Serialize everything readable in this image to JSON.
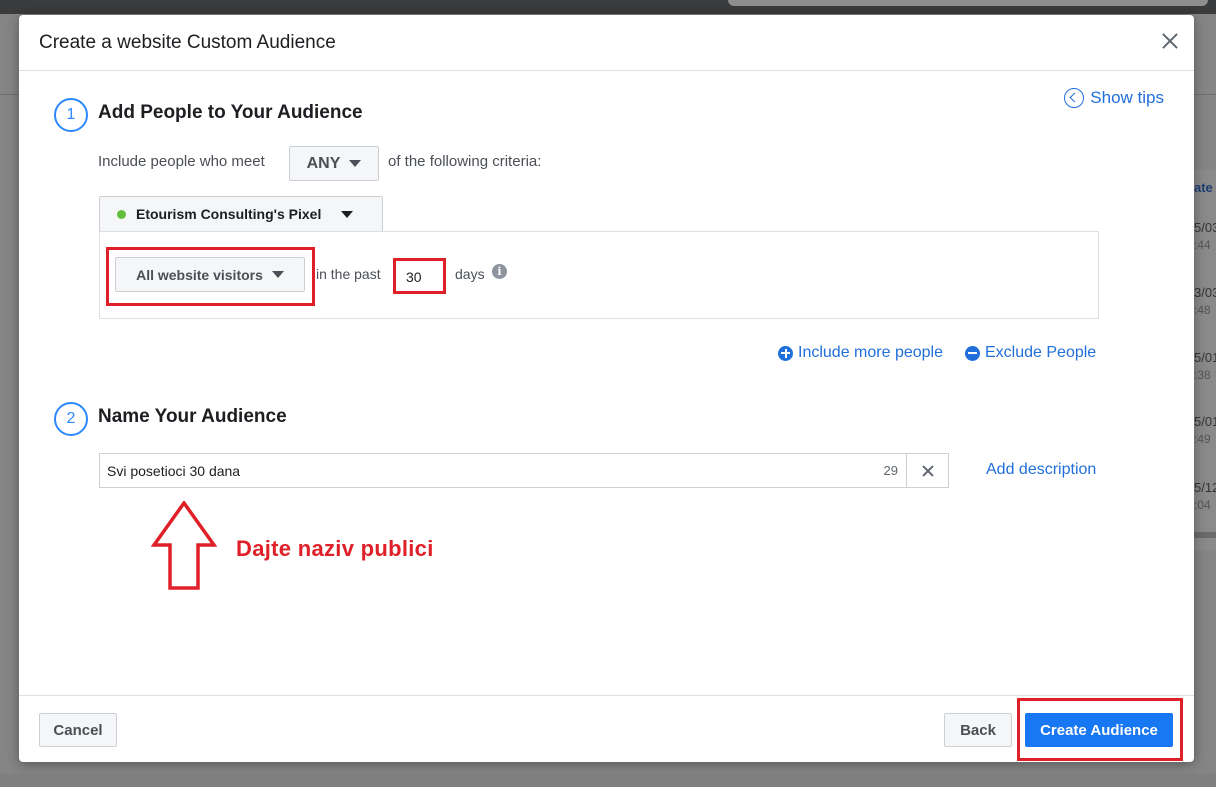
{
  "dialog": {
    "title": "Create a website Custom Audience",
    "show_tips": "Show tips"
  },
  "step1": {
    "number": "1",
    "title": "Add People to Your Audience",
    "criteria_prefix": "Include people who meet",
    "match_type": "ANY",
    "criteria_suffix": "of the following criteria:",
    "pixel_name": "Etourism Consulting's Pixel",
    "visitor_type": "All website visitors",
    "in_the_past": "in the past",
    "days_value": "30",
    "days_label": "days",
    "info_glyph": "i",
    "include_more": "Include more people",
    "exclude": "Exclude People"
  },
  "step2": {
    "number": "2",
    "title": "Name Your Audience",
    "audience_name": "Svi posetioci 30 dana",
    "char_count": "29",
    "add_description": "Add description"
  },
  "annotation": {
    "text": "Dajte naziv publici",
    "color": "#e02028"
  },
  "footer": {
    "cancel": "Cancel",
    "back": "Back",
    "create": "Create Audience"
  },
  "background_table": {
    "header": "ate",
    "rows": [
      {
        "date": "5/03",
        "time": ":44"
      },
      {
        "date": "3/03",
        "time": ":48"
      },
      {
        "date": "5/01",
        "time": ":38"
      },
      {
        "date": "5/01",
        "time": ":49"
      },
      {
        "date": "5/12",
        "time": ":04"
      }
    ]
  },
  "colors": {
    "accent": "#1877f2",
    "link": "#216fdb",
    "highlight": "#e02028",
    "status_dot": "#61bf3d"
  }
}
